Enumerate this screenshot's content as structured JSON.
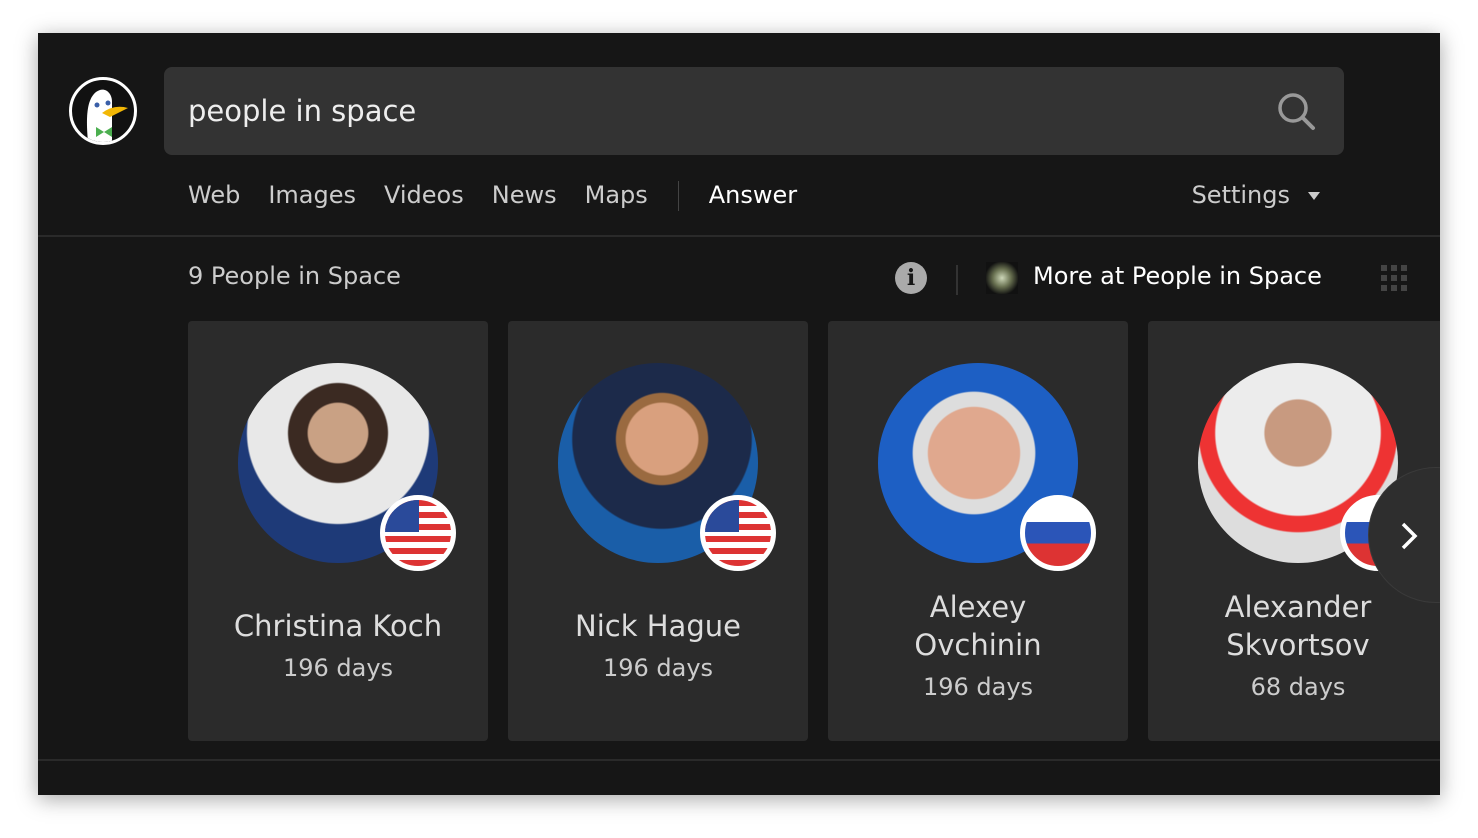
{
  "search": {
    "query": "people in space"
  },
  "nav": {
    "items": [
      "Web",
      "Images",
      "Videos",
      "News",
      "Maps"
    ],
    "active": "Answer",
    "settings": "Settings"
  },
  "answer": {
    "title": "9 People in Space",
    "more_link": "More at People in Space"
  },
  "people": [
    {
      "name": "Christina Koch",
      "days": "196 days",
      "flag": "usa"
    },
    {
      "name": "Nick Hague",
      "days": "196 days",
      "flag": "usa"
    },
    {
      "name": "Alexey Ovchinin",
      "days": "196 days",
      "flag": "russia"
    },
    {
      "name": "Alexander Skvortsov",
      "days": "68 days",
      "flag": "russia"
    }
  ],
  "colors": {
    "background": "#161616",
    "card": "#2b2b2b",
    "search": "#333333"
  }
}
